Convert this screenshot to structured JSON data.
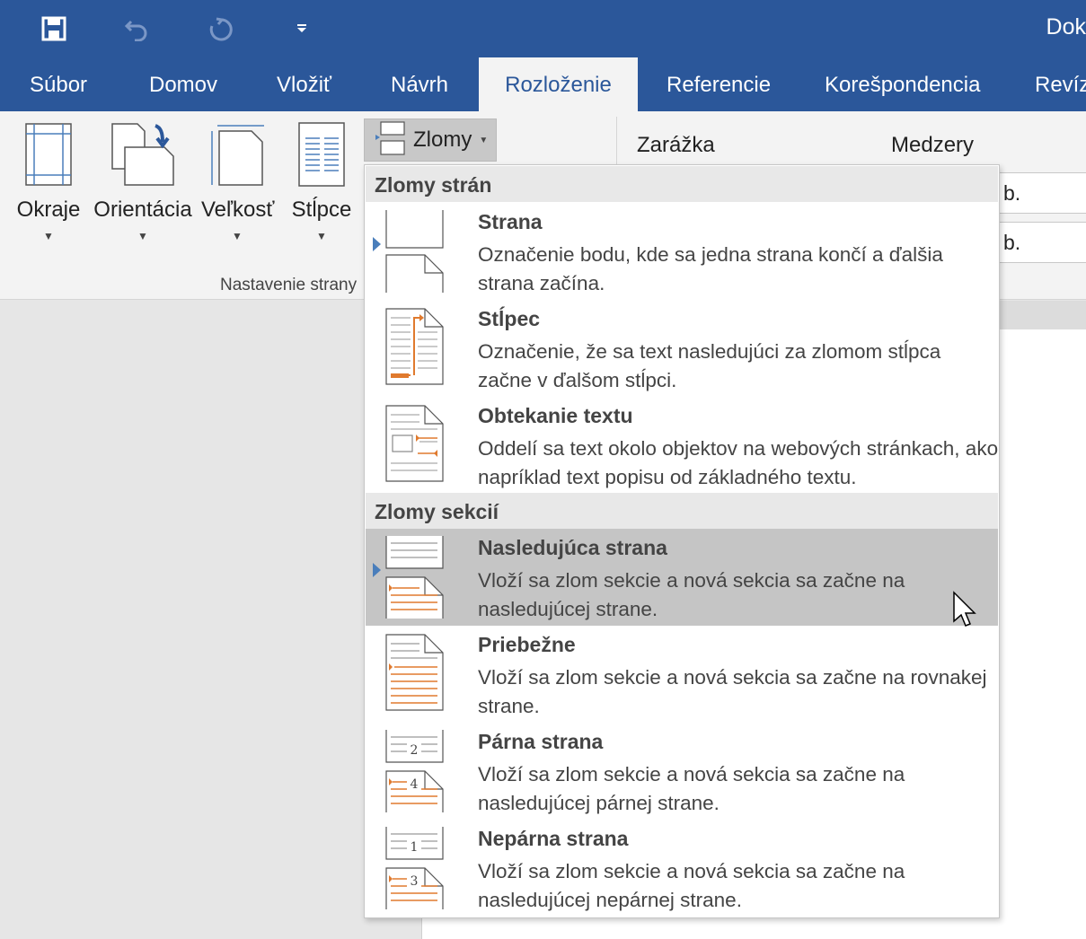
{
  "title_bar": {
    "doc_title": "Dok",
    "quick_access": [
      {
        "icon": "save-icon"
      },
      {
        "icon": "undo-icon"
      },
      {
        "icon": "redo-icon"
      },
      {
        "icon": "customize-quick-access-icon"
      }
    ]
  },
  "tabs": [
    {
      "label": "Súbor"
    },
    {
      "label": "Domov"
    },
    {
      "label": "Vložiť"
    },
    {
      "label": "Návrh"
    },
    {
      "label": "Rozloženie",
      "active": true
    },
    {
      "label": "Referencie"
    },
    {
      "label": "Korešpondencia"
    },
    {
      "label": "Revíz"
    }
  ],
  "ribbon": {
    "buttons": [
      {
        "label": "Okraje",
        "icon": "margins-icon"
      },
      {
        "label": "Orientácia",
        "icon": "orientation-icon"
      },
      {
        "label": "Veľkosť",
        "icon": "size-icon"
      },
      {
        "label": "Stĺpce",
        "icon": "columns-icon"
      }
    ],
    "group_label": "Nastavenie strany",
    "breaks_button": {
      "label": "Zlomy",
      "icon": "breaks-icon"
    },
    "indent_label": "Zarážka",
    "spacing_label": "Medzery",
    "spin_values": [
      "b.",
      "b."
    ]
  },
  "menu": {
    "sections": [
      {
        "header": "Zlomy strán",
        "items": [
          {
            "title": "Strana",
            "description": "Označenie bodu, kde sa jedna strana končí a ďalšia strana začína.",
            "icon": "page-break-icon"
          },
          {
            "title": "Stĺpec",
            "description": "Označenie, že sa text nasledujúci za zlomom stĺpca začne v ďalšom stĺpci.",
            "icon": "column-break-icon"
          },
          {
            "title": "Obtekanie textu",
            "description": "Oddelí sa text okolo objektov na webových stránkach, ako napríklad text popisu od základného textu.",
            "icon": "text-wrapping-icon"
          }
        ]
      },
      {
        "header": "Zlomy sekcií",
        "items": [
          {
            "title": "Nasledujúca strana",
            "description": "Vloží sa zlom sekcie a nová sekcia sa začne na nasledujúcej strane.",
            "icon": "next-page-section-icon",
            "hovered": true
          },
          {
            "title": "Priebežne",
            "description": "Vloží sa zlom sekcie a nová sekcia sa začne na rovnakej strane.",
            "icon": "continuous-section-icon"
          },
          {
            "title": "Párna strana",
            "description": "Vloží sa zlom sekcie a nová sekcia sa začne na nasledujúcej párnej strane.",
            "icon": "even-page-section-icon",
            "icon_numbers": [
              "2",
              "4"
            ]
          },
          {
            "title": "Nepárna strana",
            "description": "Vloží sa zlom sekcie a nová sekcia sa začne na nasledujúcej nepárnej strane.",
            "icon": "odd-page-section-icon",
            "icon_numbers": [
              "1",
              "3"
            ]
          }
        ]
      }
    ]
  },
  "colors": {
    "accent": "#2b579a",
    "hover": "#c5c5c5",
    "icon_orange": "#e07a2e",
    "marker_blue": "#4a7ebb"
  }
}
